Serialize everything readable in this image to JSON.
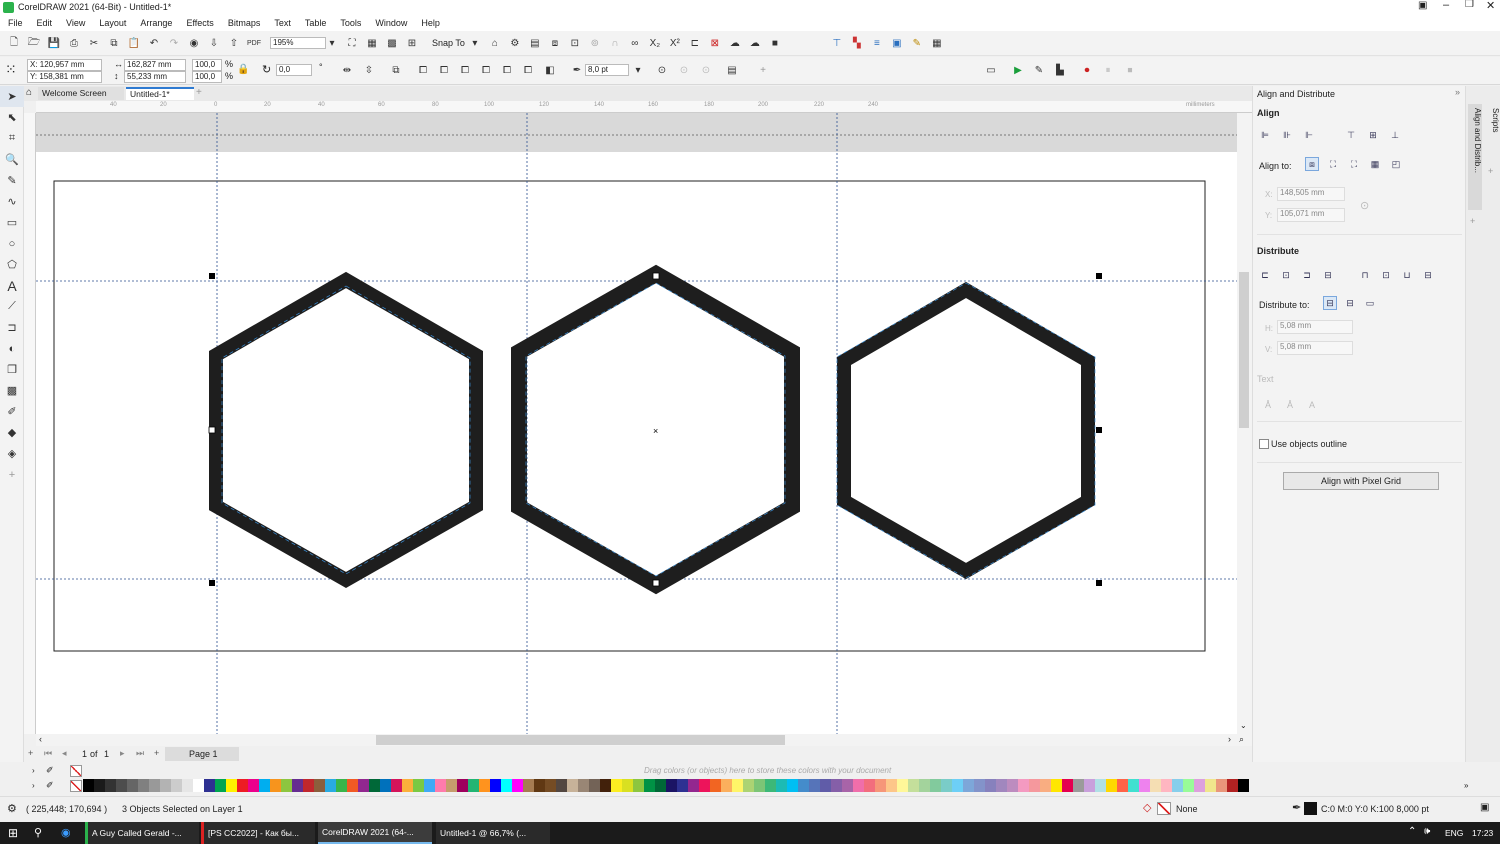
{
  "title_bar": {
    "title": "CorelDRAW 2021 (64-Bit) - Untitled-1*"
  },
  "menu": [
    "File",
    "Edit",
    "View",
    "Layout",
    "Arrange",
    "Effects",
    "Bitmaps",
    "Text",
    "Table",
    "Tools",
    "Window",
    "Help"
  ],
  "standard_toolbar": {
    "zoom": "195%",
    "snap_to": "Snap To"
  },
  "property_bar": {
    "x": "X: 120,957 mm",
    "y": "Y: 158,381 mm",
    "width": "162,827 mm",
    "height": "55,233 mm",
    "scale_x": "100,0",
    "scale_y": "100,0",
    "percent": "%",
    "rotation": "0,0",
    "degree": "°",
    "outline_width": "8,0 pt"
  },
  "doc_tabs": {
    "welcome": "Welcome Screen",
    "untitled": "Untitled-1*"
  },
  "ruler_units": "millimeters",
  "ruler_h_ticks": [
    "40",
    "20",
    "0",
    "20",
    "40",
    "60",
    "80",
    "100",
    "120",
    "140",
    "160",
    "180",
    "200",
    "220",
    "240"
  ],
  "page_nav": {
    "count": "1",
    "of": "of",
    "total": "1",
    "page_tab": "Page 1"
  },
  "palette_hint": "Drag colors (or objects) here to store these colors with your document",
  "palette_colors": [
    "#000000",
    "#1a1a1a",
    "#333333",
    "#4d4d4d",
    "#666666",
    "#808080",
    "#999999",
    "#b3b3b3",
    "#cccccc",
    "#e6e6e6",
    "#ffffff",
    "#2e3192",
    "#00a651",
    "#fff200",
    "#ed1c24",
    "#ec008c",
    "#00aeef",
    "#f7941d",
    "#8dc63f",
    "#662d91",
    "#c1272d",
    "#8b5e3c",
    "#29abe2",
    "#39b54a",
    "#f15a24",
    "#92278f",
    "#006838",
    "#0071bc",
    "#d4145a",
    "#fbb03b",
    "#7ac943",
    "#3fa9f5",
    "#ff7bac",
    "#c69c6d",
    "#9e005d",
    "#22b573",
    "#ff931e",
    "#0000ff",
    "#00ffff",
    "#ff00ff",
    "#a67c52",
    "#603813",
    "#754c24",
    "#534741",
    "#c7b299",
    "#998675",
    "#736357",
    "#42210b",
    "#fcee21",
    "#d9e021",
    "#8cc63f",
    "#009245",
    "#006837",
    "#1b1464",
    "#2e3192",
    "#93278f",
    "#ed145b",
    "#f26522",
    "#fbaf5d",
    "#fff568",
    "#acd373",
    "#7cc576",
    "#3cb878",
    "#1cbbb4",
    "#00bff3",
    "#448ccb",
    "#5674b9",
    "#605ca8",
    "#855fa8",
    "#a864a8",
    "#f06eaa",
    "#f26d7d",
    "#f69679",
    "#fdc689",
    "#fff799",
    "#c4df9b",
    "#a3d39c",
    "#82ca9d",
    "#7accc8",
    "#6dcff6",
    "#7da7d9",
    "#8393ca",
    "#8781bd",
    "#a187be",
    "#bd8cbf",
    "#f49ac1",
    "#f5989d",
    "#f9ad81",
    "#ffe600",
    "#e5004f",
    "#9b9b9b",
    "#c9a0dc",
    "#b0e0e6",
    "#ffd700",
    "#ff6347",
    "#40e0d0",
    "#ee82ee",
    "#f5deb3",
    "#ffb6c1",
    "#87ceeb",
    "#98fb98",
    "#dda0dd",
    "#f0e68c",
    "#e9967a",
    "#b22222",
    "#000000"
  ],
  "docker": {
    "title": "Align and Distribute",
    "align_label": "Align",
    "align_to_label": "Align to:",
    "x_value": "148,505 mm",
    "y_value": "105,071 mm",
    "x_prefix": "X:",
    "y_prefix": "Y:",
    "distribute_label": "Distribute",
    "distribute_to_label": "Distribute to:",
    "h_value": "5,08 mm",
    "v_value": "5,08 mm",
    "h_prefix": "H:",
    "v_prefix": "V:",
    "text_label": "Text",
    "use_outline_label": "Use objects outline",
    "pixel_grid_button": "Align with Pixel Grid"
  },
  "docker_tabs": [
    "Align and Distrib...",
    "Scripts"
  ],
  "status": {
    "coords": "( 225,448; 170,694 )",
    "selection": "3 Objects Selected on Layer 1",
    "fill": "None",
    "outline": "C:0 M:0 Y:0 K:100  8,000 pt"
  },
  "taskbar": {
    "items": [
      "A Guy Called Gerald -...",
      "[PS CC2022] - Как бы...",
      "CorelDRAW 2021 (64-...",
      "Untitled-1 @ 66,7% (..."
    ],
    "lang": "ENG",
    "time": "17:23"
  }
}
